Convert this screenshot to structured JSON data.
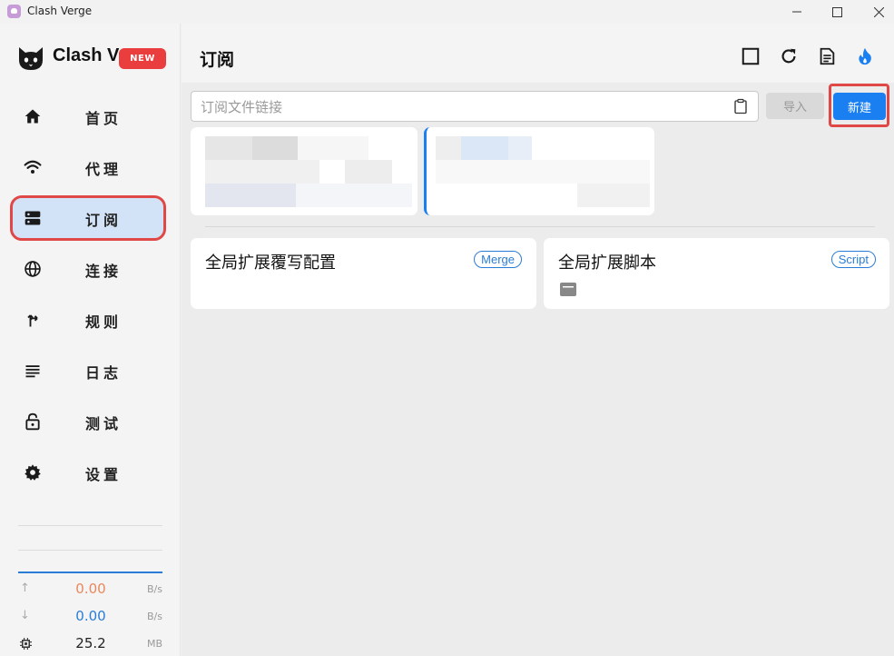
{
  "window": {
    "title": "Clash Verge"
  },
  "sidebar": {
    "logo_text": "Clash V",
    "logo_badge": "NEW",
    "items": [
      {
        "label": "首页",
        "icon": "home-icon"
      },
      {
        "label": "代理",
        "icon": "wifi-icon"
      },
      {
        "label": "订阅",
        "icon": "dns-icon",
        "active": true
      },
      {
        "label": "连接",
        "icon": "globe-icon"
      },
      {
        "label": "规则",
        "icon": "fork-icon"
      },
      {
        "label": "日志",
        "icon": "lines-icon"
      },
      {
        "label": "测试",
        "icon": "lock-icon"
      },
      {
        "label": "设置",
        "icon": "gear-icon"
      }
    ],
    "stats": {
      "upload": {
        "value": "0.00",
        "unit": "B/s",
        "color": "#e8885c"
      },
      "download": {
        "value": "0.00",
        "unit": "B/s",
        "color": "#2a7dd6"
      },
      "memory": {
        "value": "25.2",
        "unit": "MB"
      }
    }
  },
  "header": {
    "title": "订阅"
  },
  "toolbar": {
    "url_placeholder": "订阅文件链接",
    "import_label": "导入",
    "new_label": "新建"
  },
  "extensions": [
    {
      "title": "全局扩展覆写配置",
      "badge": "Merge"
    },
    {
      "title": "全局扩展脚本",
      "badge": "Script"
    }
  ],
  "colors": {
    "accent": "#1a7ff0",
    "highlight": "#e04848",
    "active_bg": "#d2e3f7"
  }
}
